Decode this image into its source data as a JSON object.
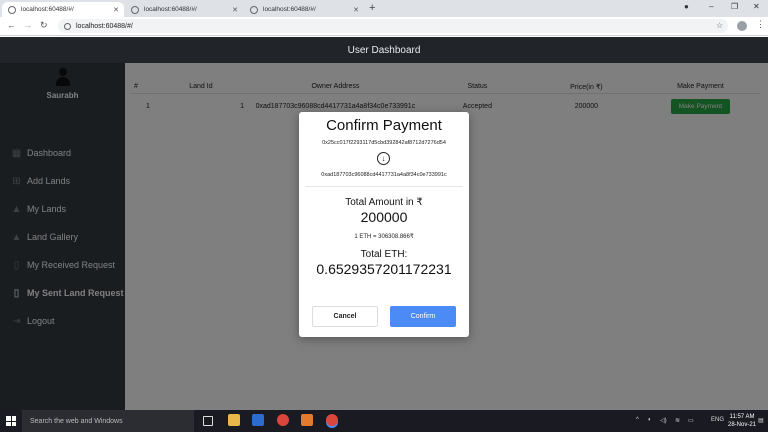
{
  "browser": {
    "tabs": [
      {
        "title": "localhost:60488/#/",
        "active": true
      },
      {
        "title": "localhost:60488/#/",
        "active": false
      },
      {
        "title": "localhost:60488/#/",
        "active": false
      }
    ],
    "url": "localhost:60488/#/"
  },
  "app": {
    "header": "User Dashboard",
    "user_name": "Saurabh"
  },
  "sidebar": {
    "items": [
      {
        "label": "Dashboard",
        "icon": "dashboard-icon"
      },
      {
        "label": "Add Lands",
        "icon": "add-chart-icon"
      },
      {
        "label": "My Lands",
        "icon": "landscape-icon"
      },
      {
        "label": "Land Gallery",
        "icon": "landscape-icon"
      },
      {
        "label": "My Received Request",
        "icon": "document-icon"
      },
      {
        "label": "My Sent Land Request",
        "icon": "document-icon"
      },
      {
        "label": "Logout",
        "icon": "logout-icon"
      }
    ],
    "active_index": 5
  },
  "table": {
    "headers": [
      "#",
      "Land Id",
      "Owner Address",
      "Status",
      "Price(in ₹)",
      "Make Payment"
    ],
    "rows": [
      {
        "index": "1",
        "land_id": "1",
        "owner": "0xad187703c96088cd4417731a4a8f34c0e733991c",
        "status": "Accepted",
        "price": "200000",
        "action": "Make Payment"
      }
    ]
  },
  "modal": {
    "title": "Confirm Payment",
    "from_address": "0x25cc017f2293117d5cbd392842af8712d7276d54",
    "to_address": "0xad187703c96088cd4417731a4a8f34c0e733991c",
    "total_amount_label": "Total Amount in ₹",
    "total_amount": "200000",
    "rate": "1 ETH = 306308.866₹",
    "total_eth_label": "Total ETH:",
    "total_eth": "0.6529357201172231",
    "cancel_label": "Cancel",
    "confirm_label": "Confirm"
  },
  "taskbar": {
    "search_placeholder": "Search the web and Windows",
    "language": "ENG",
    "time": "11:57 AM",
    "date": "28-Nov-21"
  },
  "colors": {
    "sidebar_bg": "#343a40",
    "header_bg": "#212529",
    "success": "#28a745",
    "primary": "#4c8bf5"
  }
}
